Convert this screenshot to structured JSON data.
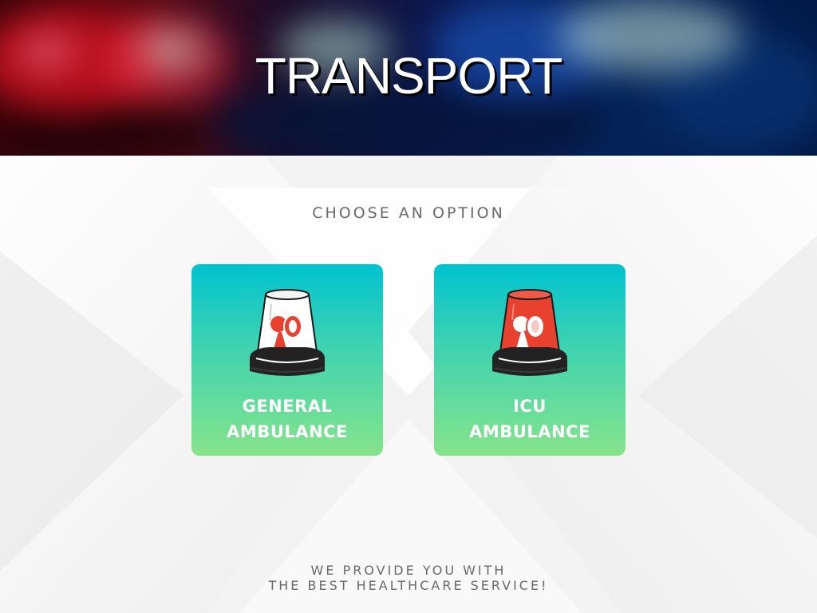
{
  "header": {
    "title": "TRANSPORT"
  },
  "main": {
    "subtitle": "CHOOSE AN OPTION",
    "options": [
      {
        "line1": "GENERAL",
        "line2": "AMBULANCE",
        "icon": "white-siren-icon"
      },
      {
        "line1": "ICU",
        "line2": "AMBULANCE",
        "icon": "red-siren-icon"
      }
    ]
  },
  "footer": {
    "line1": "WE PROVIDE YOU WITH",
    "line2": "THE BEST HEALTHCARE SERVICE!"
  },
  "colors": {
    "card_gradient_top": "#00c3cf",
    "card_gradient_bottom": "#86e48a",
    "siren_red": "#e8412f",
    "text_gray": "#6a6a6a"
  }
}
